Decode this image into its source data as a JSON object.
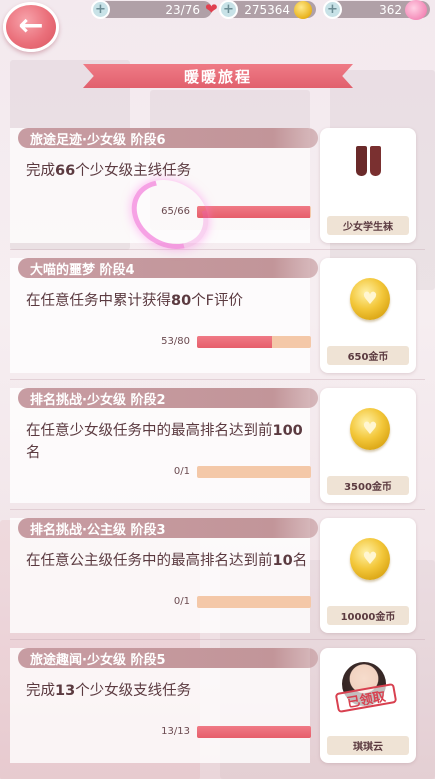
{
  "hud": {
    "stamina": "23/76",
    "gold": "275364",
    "diamonds": "362"
  },
  "title": "暖暖旅程",
  "tasks": [
    {
      "label": "旅途足迹·少女级 阶段6",
      "desc_prefix": "完成",
      "desc_num": "66",
      "desc_suffix": "个少女级主线任务",
      "count": "65/66",
      "progress": 0.985,
      "reward_name": "少女学生袜",
      "reward_icon": "socks-icon",
      "claimed": false
    },
    {
      "label": "大喵的噩梦 阶段4",
      "desc_prefix": "在任意任务中累计获得",
      "desc_num": "80",
      "desc_suffix": "个F评价",
      "count": "53/80",
      "progress": 0.6625,
      "reward_name": "650金币",
      "reward_icon": "coin-icon",
      "claimed": false
    },
    {
      "label": "排名挑战·少女级 阶段2",
      "desc_prefix": "在任意少女级任务中的最高排名达到前",
      "desc_num": "100",
      "desc_suffix": "名",
      "count": "0/1",
      "progress": 0,
      "reward_name": "3500金币",
      "reward_icon": "coin-icon",
      "claimed": false
    },
    {
      "label": "排名挑战·公主级 阶段3",
      "desc_prefix": "在任意公主级任务中的最高排名达到前",
      "desc_num": "10",
      "desc_suffix": "名",
      "count": "0/1",
      "progress": 0,
      "reward_name": "10000金币",
      "reward_icon": "coin-icon",
      "claimed": false
    },
    {
      "label": "旅途趣闻·少女级 阶段5",
      "desc_prefix": "完成",
      "desc_num": "13",
      "desc_suffix": "个少女级支线任务",
      "count": "13/13",
      "progress": 1.0,
      "reward_name": "琪琪云",
      "reward_icon": "avatar-icon",
      "claimed": true,
      "claimed_label": "已领取"
    }
  ],
  "colors": {
    "accent": "#e1606d",
    "progress_fill": "#e65e6b",
    "progress_track": "#f4c8a8",
    "label_bg": "#c29599"
  }
}
